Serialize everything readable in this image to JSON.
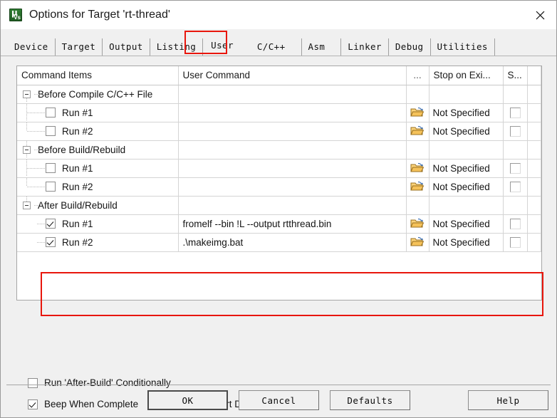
{
  "window": {
    "title": "Options for Target 'rt-thread'",
    "icon": "uvision-icon",
    "close_label": "✕",
    "accent_red": "#e8160c"
  },
  "tabs": [
    {
      "label": "Device",
      "selected": false
    },
    {
      "label": "Target",
      "selected": false
    },
    {
      "label": "Output",
      "selected": false
    },
    {
      "label": "Listing",
      "selected": false
    },
    {
      "label": "User",
      "selected": true
    },
    {
      "label": "C/C++",
      "selected": false
    },
    {
      "label": "Asm",
      "selected": false
    },
    {
      "label": "Linker",
      "selected": false
    },
    {
      "label": "Debug",
      "selected": false
    },
    {
      "label": "Utilities",
      "selected": false
    }
  ],
  "grid": {
    "headers": {
      "command_items": "Command Items",
      "user_command": "User Command",
      "dots": "...",
      "stop_on_exit": "Stop on Exi...",
      "s": "S..."
    },
    "rows": [
      {
        "type": "group",
        "label": "Before Compile C/C++ File",
        "expanded": true
      },
      {
        "type": "child",
        "label": "Run #1",
        "checked": false,
        "command": "",
        "stop": "Not Specified",
        "browse": true,
        "sbox": true
      },
      {
        "type": "child",
        "label": "Run #2",
        "checked": false,
        "command": "",
        "stop": "Not Specified",
        "browse": true,
        "sbox": true
      },
      {
        "type": "group",
        "label": "Before Build/Rebuild",
        "expanded": true
      },
      {
        "type": "child",
        "label": "Run #1",
        "checked": false,
        "command": "",
        "stop": "Not Specified",
        "browse": true,
        "sbox": true
      },
      {
        "type": "child",
        "label": "Run #2",
        "checked": false,
        "command": "",
        "stop": "Not Specified",
        "browse": true,
        "sbox": true
      },
      {
        "type": "group",
        "label": "After Build/Rebuild",
        "expanded": true
      },
      {
        "type": "child",
        "label": "Run #1",
        "checked": true,
        "command": "fromelf --bin !L --output rtthread.bin",
        "stop": "Not Specified",
        "browse": true,
        "sbox": true,
        "highlight": true
      },
      {
        "type": "child",
        "label": "Run #2",
        "checked": true,
        "command": ".\\makeimg.bat",
        "stop": "Not Specified",
        "browse": true,
        "sbox": true,
        "highlight": true
      }
    ]
  },
  "options": {
    "run_after_build_conditionally": {
      "label": "Run 'After-Build' Conditionally",
      "checked": false
    },
    "beep_when_complete": {
      "label": "Beep When Complete",
      "checked": true
    },
    "start_debugging": {
      "label": "Start Debugging",
      "checked": false
    }
  },
  "footer": {
    "ok": "OK",
    "cancel": "Cancel",
    "defaults": "Defaults",
    "help": "Help"
  }
}
